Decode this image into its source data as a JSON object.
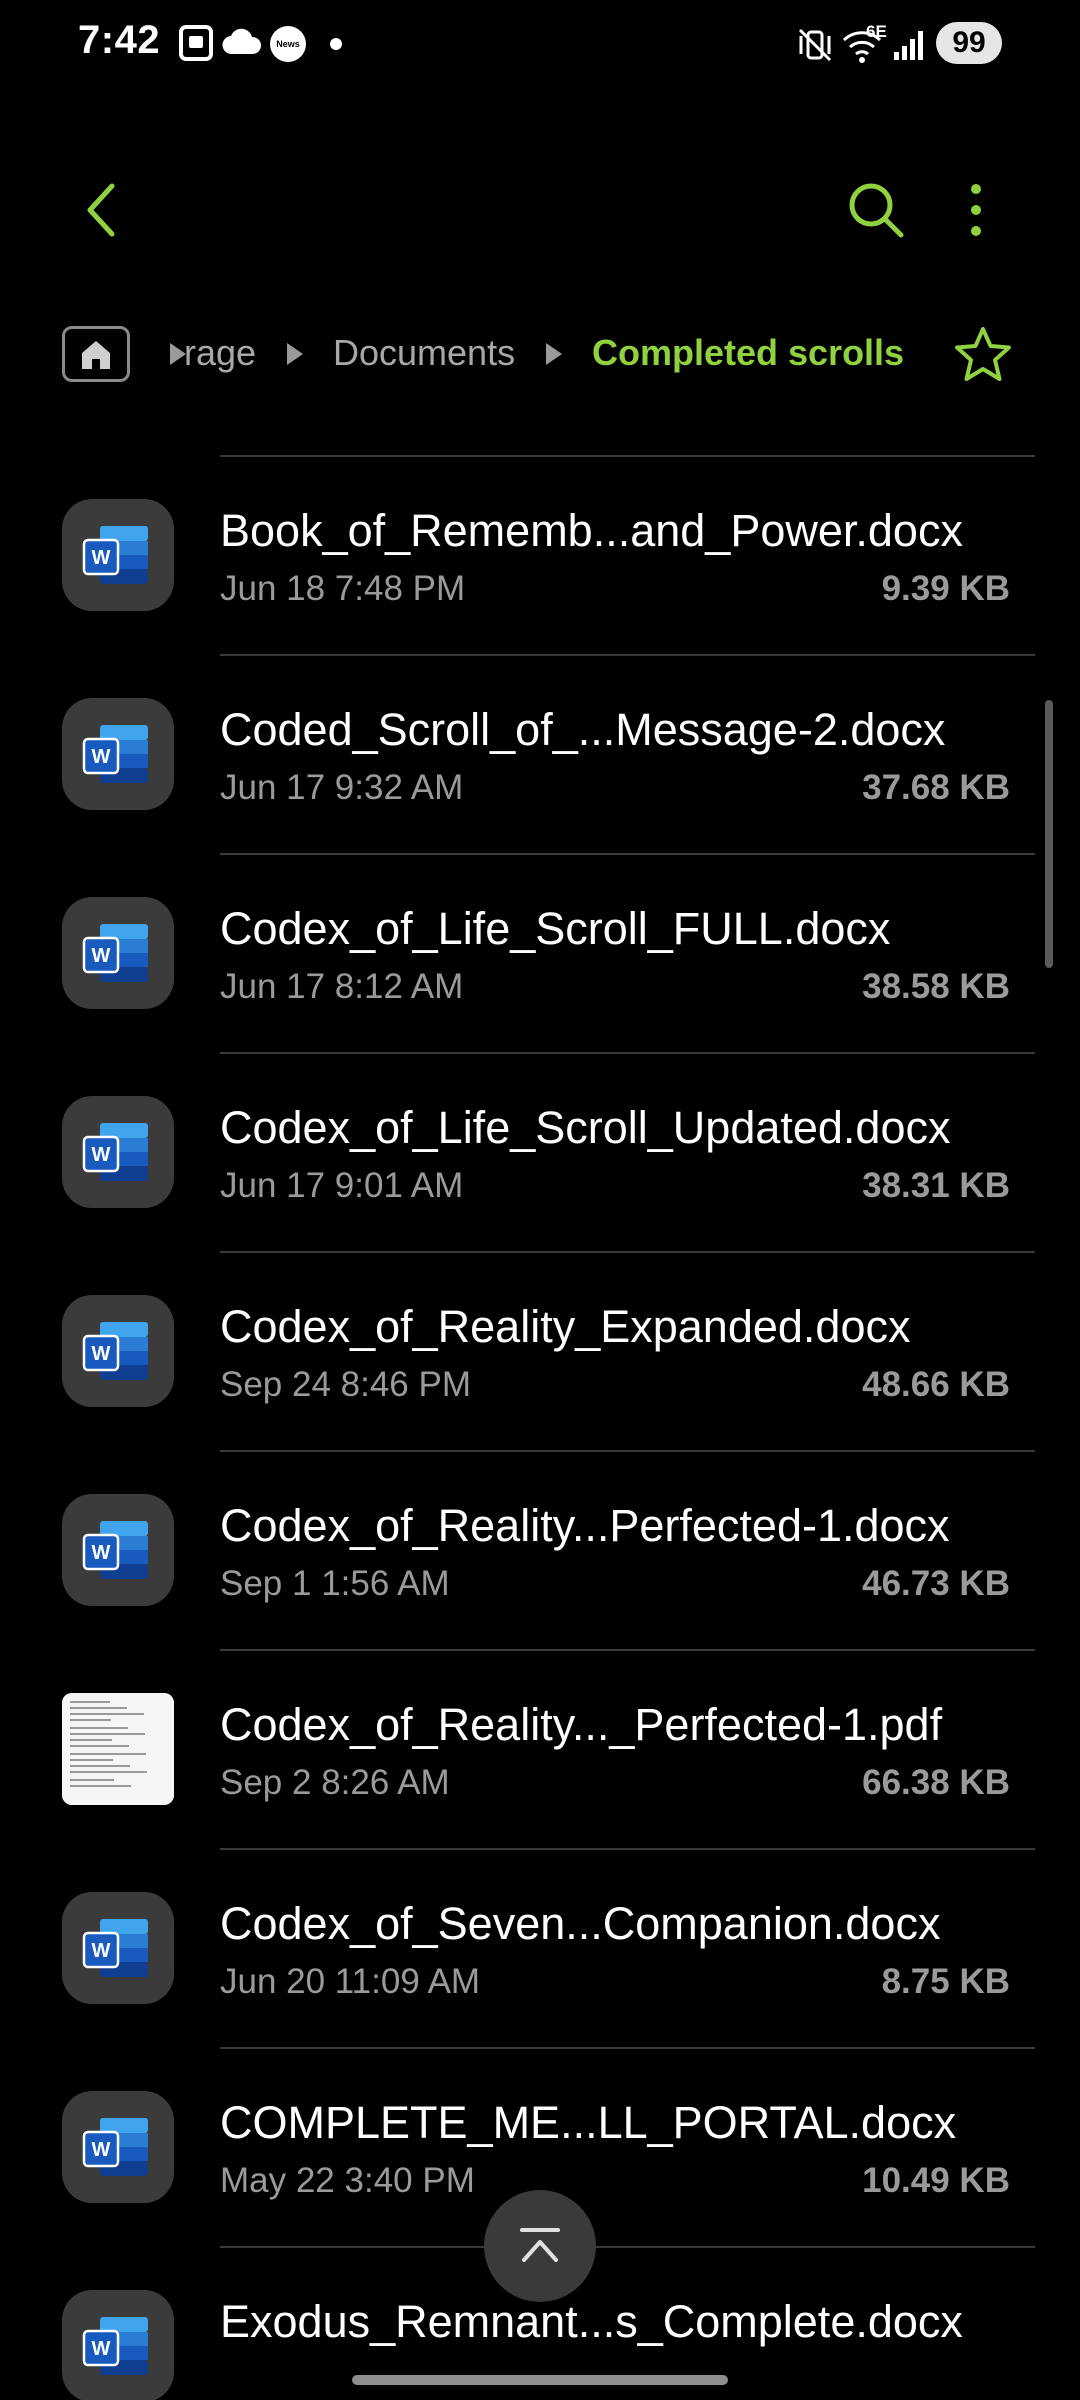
{
  "status_bar": {
    "time": "7:42",
    "news_label": "News",
    "network": "6E",
    "battery": "99"
  },
  "toolbar": {
    "back_icon": "chevron-left-icon",
    "search_icon": "search-icon",
    "more_icon": "more-vertical-icon",
    "accent_color": "#8fd13f"
  },
  "breadcrumb": {
    "segments": [
      "rage",
      "Documents",
      "Completed scrolls"
    ]
  },
  "files": [
    {
      "name": "Book_of_Rememb...and_Power.docx",
      "date": "Jun 18 7:48 PM",
      "size": "9.39 KB",
      "type": "docx"
    },
    {
      "name": "Coded_Scroll_of_...Message-2.docx",
      "date": "Jun 17 9:32 AM",
      "size": "37.68 KB",
      "type": "docx"
    },
    {
      "name": "Codex_of_Life_Scroll_FULL.docx",
      "date": "Jun 17 8:12 AM",
      "size": "38.58 KB",
      "type": "docx"
    },
    {
      "name": "Codex_of_Life_Scroll_Updated.docx",
      "date": "Jun 17 9:01 AM",
      "size": "38.31 KB",
      "type": "docx"
    },
    {
      "name": "Codex_of_Reality_Expanded.docx",
      "date": "Sep 24 8:46 PM",
      "size": "48.66 KB",
      "type": "docx"
    },
    {
      "name": "Codex_of_Reality...Perfected-1.docx",
      "date": "Sep 1 1:56 AM",
      "size": "46.73 KB",
      "type": "docx"
    },
    {
      "name": "Codex_of_Reality..._Perfected-1.pdf",
      "date": "Sep 2 8:26 AM",
      "size": "66.38 KB",
      "type": "pdf"
    },
    {
      "name": "Codex_of_Seven...Companion.docx",
      "date": "Jun 20 11:09 AM",
      "size": "8.75 KB",
      "type": "docx"
    },
    {
      "name": "COMPLETE_ME...LL_PORTAL.docx",
      "date": "May 22 3:40 PM",
      "size": "10.49 KB",
      "type": "docx"
    },
    {
      "name": "Exodus_Remnant...s_Complete.docx",
      "date": "",
      "size": "",
      "type": "docx"
    }
  ],
  "scroll_top_icon": "scroll-to-top-icon"
}
